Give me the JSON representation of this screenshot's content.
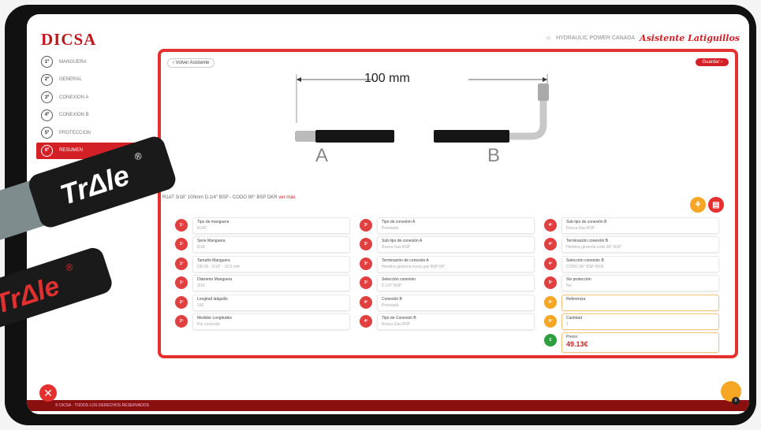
{
  "app": {
    "logo": "DICSA",
    "header_text": "HYDRAULIC POWER CANADA",
    "brand_script": "Asistente Latiguillos"
  },
  "sidebar": {
    "items": [
      {
        "num": "1º",
        "label": "MANGUERA",
        "active": false
      },
      {
        "num": "2º",
        "label": "GENERAL",
        "active": false
      },
      {
        "num": "3º",
        "label": "CONEXION A",
        "active": false
      },
      {
        "num": "4º",
        "label": "CONEXION B",
        "active": false
      },
      {
        "num": "5º",
        "label": "PROTECCION",
        "active": false
      },
      {
        "num": "6º",
        "label": "RESUMEN",
        "active": true
      }
    ]
  },
  "panel": {
    "back_label": "Volver Asistente",
    "next_label": "Guardar",
    "measure_label": "100 mm",
    "end_a": "A",
    "end_b": "B",
    "summary_text": "R1AT 3/16\" 100mm D.1/4\" BSP - CODO 90° BSP DKR",
    "summary_link": "ver más"
  },
  "columns": [
    [
      {
        "badge": "1º",
        "label": "Tipo de manguera",
        "value": "R1AT",
        "kind": "red"
      },
      {
        "badge": "1º",
        "label": "Serie Manguera",
        "value": "R1A",
        "kind": "red"
      },
      {
        "badge": "1º",
        "label": "Tamaño Manguera",
        "value": "DN 05 - 3/16\" - 10,5 mm",
        "kind": "red"
      },
      {
        "badge": "1º",
        "label": "Diámetro Manguera",
        "value": "3/16",
        "kind": "red"
      },
      {
        "badge": "2º",
        "label": "Longitud latiguillo",
        "value": "100",
        "kind": "red"
      },
      {
        "badge": "2º",
        "label": "Medidor Longitudes",
        "value": "Por conexión",
        "kind": "red"
      }
    ],
    [
      {
        "badge": "3º",
        "label": "Tipo de conexión A",
        "value": "Prensado",
        "kind": "red"
      },
      {
        "badge": "3º",
        "label": "Sub tipo de conexión A",
        "value": "Rosca Gas BSP",
        "kind": "red"
      },
      {
        "badge": "3º",
        "label": "Terminación de conexión A",
        "value": "Hembra giratoria rosca gas BSP 60°",
        "kind": "red"
      },
      {
        "badge": "3º",
        "label": "Selección conexión",
        "value": "D.1/4\" BSP",
        "kind": "red"
      },
      {
        "badge": "4º",
        "label": "Conexión B",
        "value": "Prensado",
        "kind": "red"
      },
      {
        "badge": "4º",
        "label": "Tipo de Conexión B",
        "value": "Rosca Gas BSP",
        "kind": "red"
      }
    ],
    [
      {
        "badge": "4º",
        "label": "Sub tipo de conexión B",
        "value": "Rosca Gas BSP",
        "kind": "red"
      },
      {
        "badge": "4º",
        "label": "Terminación conexión B",
        "value": "Hembra giratoria codo 90° BSP",
        "kind": "red"
      },
      {
        "badge": "4º",
        "label": "Selección conexión B",
        "value": "CODO 90° BSP DKR",
        "kind": "red"
      },
      {
        "badge": "5º",
        "label": "Sin protección",
        "value": "No",
        "kind": "red"
      },
      {
        "badge": "6º",
        "label": "Referencia",
        "value": "",
        "kind": "orange"
      },
      {
        "badge": "6º",
        "label": "Cantidad",
        "value": "1",
        "kind": "orange"
      },
      {
        "badge": "€",
        "label": "Precio",
        "value": "",
        "kind": "green",
        "price": "49.13€"
      }
    ]
  ],
  "footer": {
    "text": "© DICSA · TODOS LOS DERECHOS RESERVADOS"
  },
  "cart": {
    "count": "0"
  },
  "overlay": {
    "brand_1": "TrΔle",
    "brand_2": "TrΔle",
    "reg": "®"
  },
  "colors": {
    "brand_red": "#d32026",
    "accent_orange": "#f5a623",
    "ok_green": "#2e9e3f"
  }
}
